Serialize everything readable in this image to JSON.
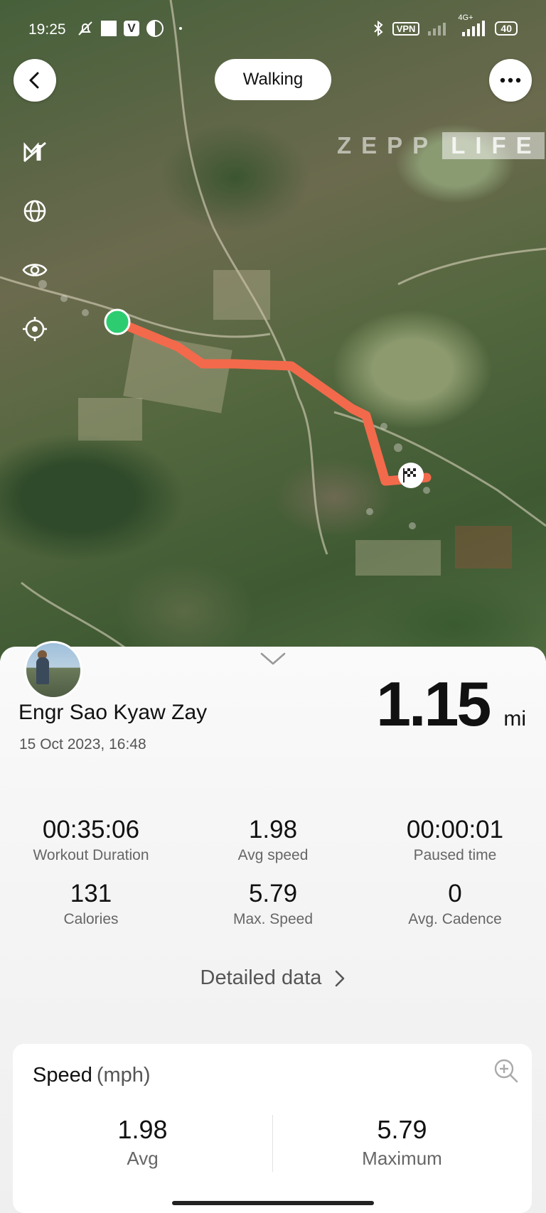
{
  "status_bar": {
    "time": "19:25",
    "vpn": "VPN",
    "network": "4G+",
    "battery": "40"
  },
  "header": {
    "activity": "Walking"
  },
  "watermark": {
    "part1": "ZEPP",
    "part2": "LIFE"
  },
  "summary": {
    "user_name": "Engr Sao Kyaw Zay",
    "datetime": "15 Oct 2023, 16:48",
    "distance": "1.15",
    "distance_unit": "mi"
  },
  "stats": [
    {
      "value": "00:35:06",
      "label": "Workout Duration"
    },
    {
      "value": "1.98",
      "label": "Avg speed"
    },
    {
      "value": "00:00:01",
      "label": "Paused time"
    },
    {
      "value": "131",
      "label": "Calories"
    },
    {
      "value": "5.79",
      "label": "Max. Speed"
    },
    {
      "value": "0",
      "label": "Avg. Cadence"
    }
  ],
  "detailed_data_label": "Detailed data",
  "speed_card": {
    "title": "Speed",
    "unit": "(mph)",
    "avg_value": "1.98",
    "avg_label": "Avg",
    "max_value": "5.79",
    "max_label": "Maximum"
  },
  "colors": {
    "route": "#f26a4b",
    "start_marker": "#2ecc71"
  }
}
